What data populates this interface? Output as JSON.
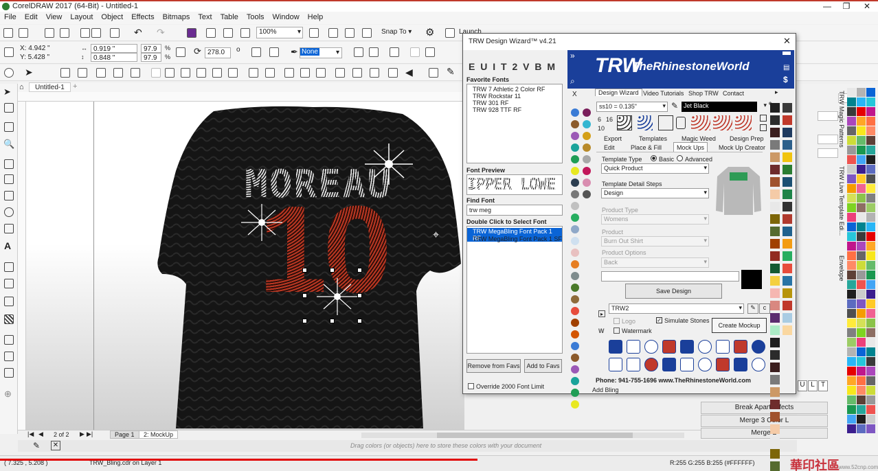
{
  "app": {
    "title": "CorelDRAW 2017 (64-Bit) - Untitled-1",
    "menu": [
      "File",
      "Edit",
      "View",
      "Layout",
      "Object",
      "Effects",
      "Bitmaps",
      "Text",
      "Table",
      "Tools",
      "Window",
      "Help"
    ]
  },
  "toolbar": {
    "zoom": "100%",
    "snap_to": "Snap To",
    "launch": "Launch"
  },
  "propbar": {
    "x": "X: 4.942 \"",
    "y": "Y: 5.428 \"",
    "w": "0.919 \"",
    "h": "0.848 \"",
    "sx": "97.9",
    "sy": "97.9",
    "pct": "%",
    "angle": "278.0",
    "outline": "None"
  },
  "document": {
    "tab": "Untitled-1",
    "pages": [
      "Page 1",
      "2: MockUp"
    ],
    "page_counter": "2 of 2",
    "name_text": "MOREAU",
    "number_text": "10"
  },
  "colorbar": {
    "hint": "Drag colors (or objects) here to store these colors with your document"
  },
  "status": {
    "coords": "( 7.325 , 5.208 )",
    "layer_info": "TRW_Bling.cdr on Layer 1",
    "color_info": "R:255 G:255 B:255 (#FFFFFF)"
  },
  "dialog": {
    "title": "TRW Design Wizard™ v4.21",
    "font_letters": "E U I T 2 V B M",
    "favorite_fonts_label": "Favorite Fonts",
    "favorite_fonts": [
      "TRW 7 Athletic 2 Color RF",
      "TRW Rockstar 11",
      "TRW 301 RF",
      "TRW 928 TTF RF"
    ],
    "font_preview_label": "Font Preview",
    "font_preview_text": "IPPER LOWE",
    "find_font_label": "Find Font",
    "find_font_value": "trw meg",
    "double_click_label": "Double Click to Select Font",
    "font_results": [
      "TRW MegaBling Font Pack 1 RF",
      "TRW MegaBling Font Pack 1 SF"
    ],
    "remove_favs": "Remove from Favs",
    "add_favs": "Add to Favs",
    "override_label": "Override 2000 Font Limit",
    "brand": "TheRhinestoneWorld",
    "logo": "TRW",
    "tabs": [
      "Design Wizard",
      "Video Tutorials",
      "Shop TRW",
      "Contact"
    ],
    "stone_size": "ss10 = 0.135\"",
    "stone_color": "Jet Black",
    "num_labels": [
      "6",
      "16",
      "10"
    ],
    "subtabs_row1": [
      "Export",
      "Templates",
      "Magic Weed",
      "Design Prep"
    ],
    "subtabs_row2": [
      "Edit",
      "Place & Fill",
      "Mock Ups",
      "Mock Up Creator"
    ],
    "template_type_label": "Template Type",
    "radio_basic": "Basic",
    "radio_advanced": "Advanced",
    "template_type_value": "Quick Product",
    "template_steps_label": "Template Detail Steps",
    "template_steps_value": "Design",
    "product_type_label": "Product Type",
    "product_type_value": "Womens",
    "product_label": "Product",
    "product_value": "Burn Out Shirt",
    "product_options_label": "Product Options",
    "product_options_value": "Back",
    "save_design": "Save Design",
    "trw2_value": "TRW2",
    "c_button": "c",
    "logo_check": "Logo",
    "watermark_check": "Watermark",
    "simulate_stones": "Simulate Stones",
    "create_mockup": "Create Mockup",
    "phone": "Phone: 941-755-1696  www.TheRhinestoneWorld.com",
    "add_bling": "Add Bling",
    "x_label": "X",
    "w_label": "W"
  },
  "rightpanel": {
    "effects_buttons": [
      "Break Apart Effects",
      "Merge 3 Color L",
      "Merge D"
    ],
    "vertical_tabs": [
      "TRW Magic Patterns",
      "TRW Live Template Edi...",
      "Envelope"
    ],
    "ult": [
      "U",
      "L",
      "T"
    ]
  },
  "watermark_text": "華印社區",
  "watermark_url": "www.52cnp.com",
  "colors": {
    "title_red": "#c0392b",
    "dialog_blue": "#1a3f9a",
    "select_blue": "#0a64d6"
  }
}
